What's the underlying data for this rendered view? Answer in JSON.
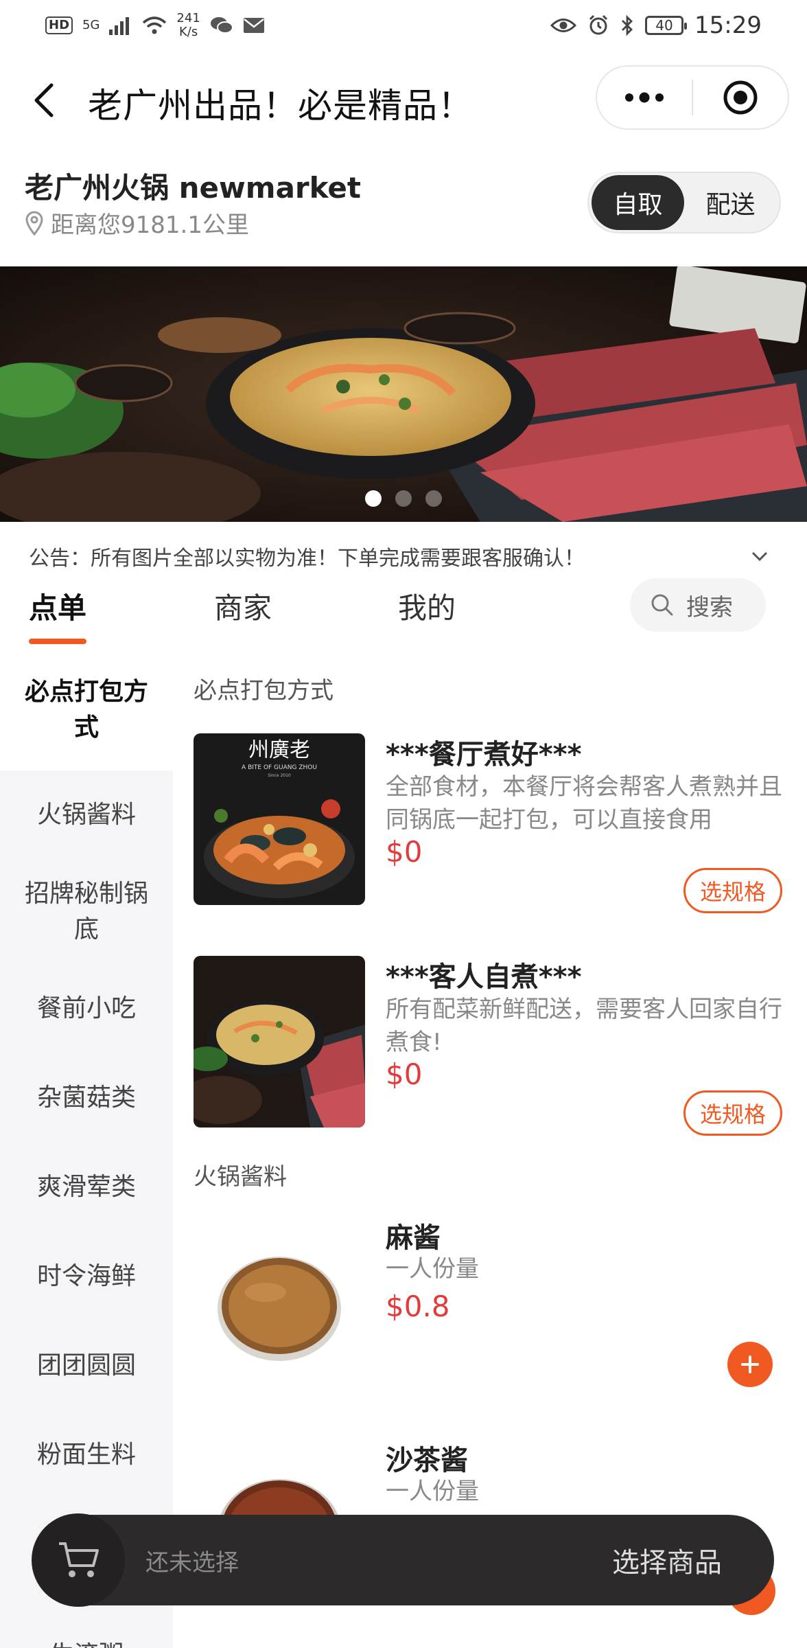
{
  "status_bar": {
    "network_hd": "HD",
    "network_5g": "5G",
    "speed_value": "241",
    "speed_unit": "K/s",
    "battery": "40",
    "time": "15:29"
  },
  "nav": {
    "title": "老广州出品！必是精品！"
  },
  "store": {
    "name": "老广州火锅 newmarket",
    "distance": "距离您9181.1公里",
    "mode_options": [
      "自取",
      "配送"
    ],
    "mode_selected": "自取"
  },
  "banner": {
    "slide_count": 3,
    "active_slide": 1
  },
  "notice": {
    "text": "公告：所有图片全部以实物为准！下单完成需要跟客服确认！"
  },
  "tabs": {
    "items": [
      "点单",
      "商家",
      "我的"
    ],
    "active": "点单",
    "search_label": "搜索"
  },
  "categories": {
    "items": [
      "必点打包方式",
      "火锅酱料",
      "招牌秘制锅底",
      "餐前小吃",
      "杂菌菇类",
      "爽滑荤类",
      "时令海鲜",
      "团团圆圆",
      "粉面生料",
      "生滚粥"
    ],
    "active": "必点打包方式"
  },
  "sections": [
    {
      "title": "必点打包方式",
      "products": [
        {
          "name": "***餐厅煮好***",
          "desc": "全部食材，本餐厅将会帮客人煮熟并且同锅底一起打包，可以直接食用",
          "price": "$0",
          "action": "选规格",
          "image_text": "州廣老",
          "image_subtext": "A BITE OF GUANG ZHOU",
          "image_since": "Since 2010"
        },
        {
          "name": "***客人自煮***",
          "desc": "所有配菜新鲜配送，需要客人回家自行煮食!",
          "price": "$0",
          "action": "选规格"
        }
      ]
    },
    {
      "title": "火锅酱料",
      "products": [
        {
          "name": "麻酱",
          "desc": "一人份量",
          "price": "$0.8"
        },
        {
          "name": "沙茶酱",
          "desc": "一人份量"
        }
      ]
    }
  ],
  "cart": {
    "empty_text": "还未选择",
    "action": "选择商品"
  },
  "colors": {
    "accent": "#f05a22",
    "price": "#e23b3b",
    "dark": "#2c2a2a"
  }
}
